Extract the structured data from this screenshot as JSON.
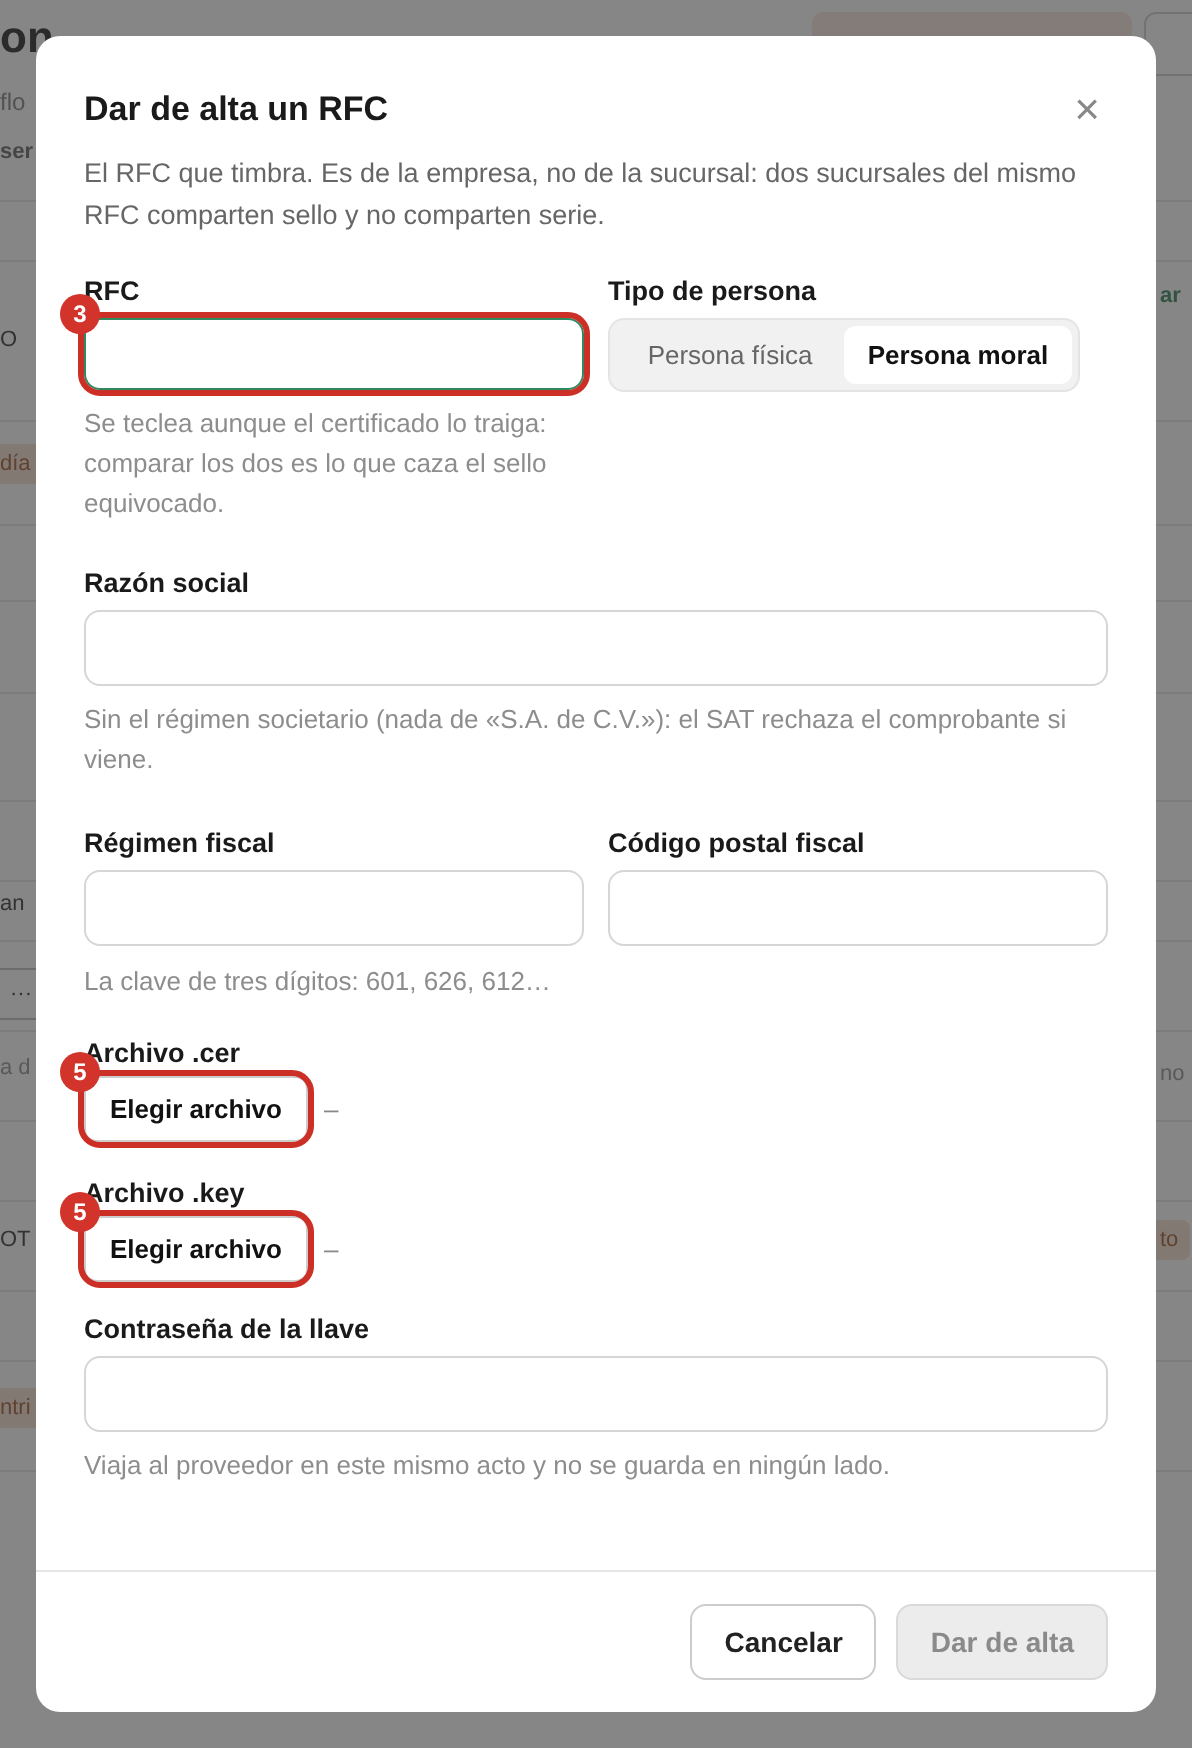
{
  "backdrop": {
    "title": "on",
    "subtitle": "flo",
    "left": [
      {
        "text": "ser",
        "kind": "tab"
      },
      {
        "text": "O",
        "kind": "plain"
      },
      {
        "text": "día",
        "kind": "tag"
      },
      {
        "text": "an",
        "kind": "plain"
      },
      {
        "text": "···",
        "kind": "button"
      },
      {
        "text": "a d",
        "kind": "muted"
      },
      {
        "text": "OT",
        "kind": "plain"
      },
      {
        "text": "ntri",
        "kind": "tag"
      }
    ],
    "right": [
      {
        "text": "ar",
        "kind": "green"
      },
      {
        "text": "no",
        "kind": "muted"
      },
      {
        "text": "to",
        "kind": "tag"
      }
    ]
  },
  "dialog": {
    "title": "Dar de alta un RFC",
    "close": "×",
    "intro": "El RFC que timbra. Es de la empresa, no de la sucursal: dos sucursales del mismo RFC comparten sello y no comparten serie.",
    "rfc": {
      "label": "RFC",
      "marker": "3",
      "hint": "Se teclea aunque el certificado lo traiga: comparar los dos es lo que caza el sello equivocado."
    },
    "tipo": {
      "label": "Tipo de persona",
      "options": [
        {
          "label": "Persona física",
          "selected": false
        },
        {
          "label": "Persona moral",
          "selected": true
        }
      ]
    },
    "razon": {
      "label": "Razón social",
      "hint": "Sin el régimen societario (nada de «S.A. de C.V.»): el SAT rechaza el comprobante si viene."
    },
    "regimen": {
      "label": "Régimen fiscal",
      "hint": "La clave de tres dígitos: 601, 626, 612…"
    },
    "cp": {
      "label": "Código postal fiscal"
    },
    "files": [
      {
        "label": "Archivo .cer",
        "button": "Elegir archivo",
        "marker": "5",
        "status": "–"
      },
      {
        "label": "Archivo .key",
        "button": "Elegir archivo",
        "marker": "5",
        "status": "–"
      }
    ],
    "password": {
      "label": "Contraseña de la llave",
      "hint": "Viaja al proveedor en este mismo acto y no se guarda en ningún lado."
    },
    "buttons": [
      {
        "label": "Cancelar",
        "disabled": false
      },
      {
        "label": "Dar de alta",
        "disabled": true
      }
    ]
  }
}
